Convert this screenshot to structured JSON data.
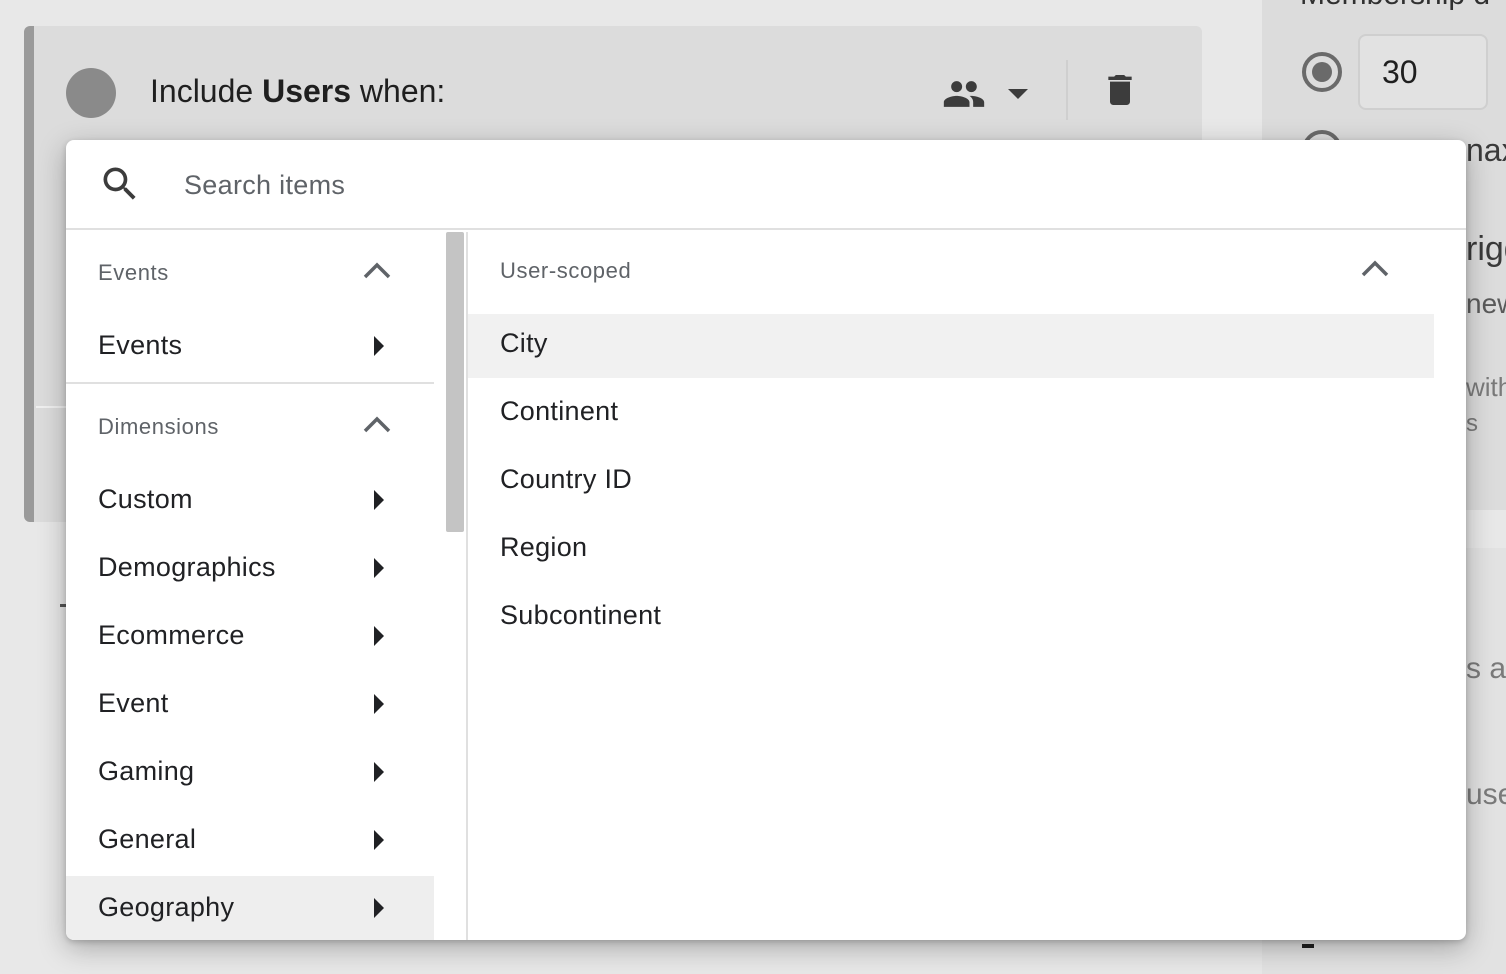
{
  "header": {
    "title_prefix": "Include ",
    "title_bold": "Users",
    "title_suffix": " when:"
  },
  "side_panel": {
    "title_peek": "Membership d",
    "duration_value": "30",
    "peek_texts": [
      "nax",
      "rigg",
      "new",
      "with",
      "s",
      "s au",
      "use"
    ]
  },
  "search": {
    "placeholder": "Search items"
  },
  "left_menu": {
    "sections": [
      {
        "label": "Events",
        "items": [
          {
            "label": "Events"
          }
        ]
      },
      {
        "label": "Dimensions",
        "items": [
          {
            "label": "Custom"
          },
          {
            "label": "Demographics"
          },
          {
            "label": "Ecommerce"
          },
          {
            "label": "Event"
          },
          {
            "label": "Gaming"
          },
          {
            "label": "General"
          },
          {
            "label": "Geography"
          }
        ]
      }
    ],
    "selected": "Geography"
  },
  "right_panel": {
    "section_label": "User-scoped",
    "options": [
      {
        "label": "City"
      },
      {
        "label": "Continent"
      },
      {
        "label": "Country ID"
      },
      {
        "label": "Region"
      },
      {
        "label": "Subcontinent"
      }
    ],
    "highlighted": "City"
  },
  "colors": {
    "popup_bg": "#ffffff",
    "selected_bg": "#eeeeee",
    "overlay_bg": "#e8e8e8",
    "icon_gray": "#5f6368"
  }
}
